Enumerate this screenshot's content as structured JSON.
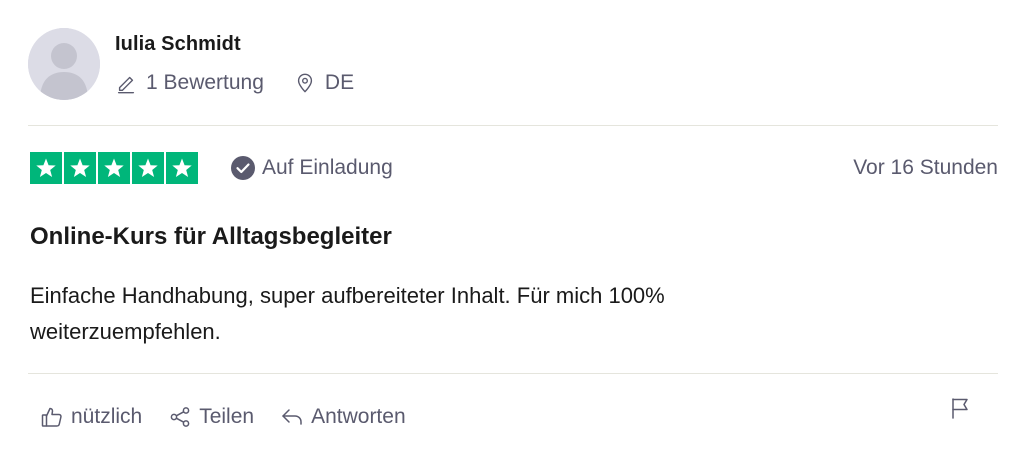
{
  "colors": {
    "star_green": "#00b67a",
    "text_primary": "#1a1a1a",
    "text_secondary": "#5a5a6e",
    "divider": "#e5e5dd"
  },
  "reviewer": {
    "name": "Iulia Schmidt",
    "review_count": "1 Bewertung",
    "country": "DE",
    "avatar_icon": "person-silhouette-icon"
  },
  "review": {
    "rating": 5,
    "rating_max": 5,
    "invited_label": "Auf Einladung",
    "date": "Vor 16 Stunden",
    "title": "Online-Kurs für Alltagsbegleiter",
    "body": "Einfache Handhabung, super aufbereiteter Inhalt. Für mich 100% weiterzuempfehlen."
  },
  "actions": {
    "useful": "nützlich",
    "share": "Teilen",
    "reply": "Antworten"
  },
  "icons": {
    "review_count": "pencil-icon",
    "country": "location-pin-icon",
    "invited": "verified-check-icon",
    "useful": "thumbs-up-icon",
    "share": "share-icon",
    "reply": "reply-arrow-icon",
    "report": "flag-icon"
  }
}
